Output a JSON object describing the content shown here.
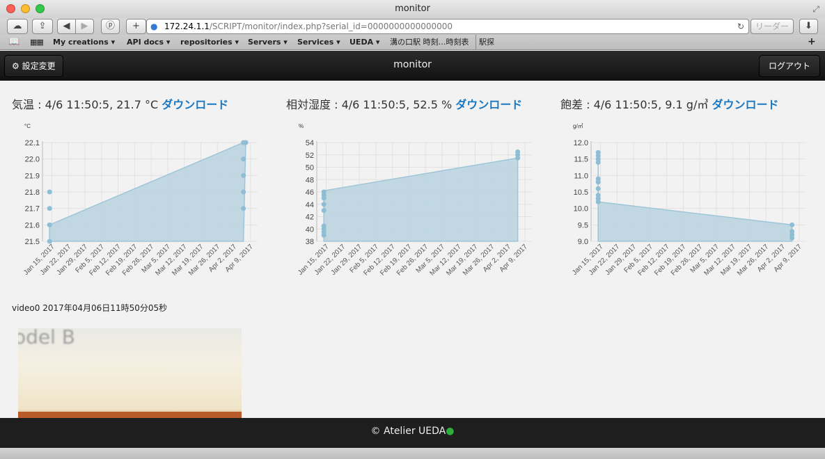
{
  "browser": {
    "window_title": "monitor",
    "url_host": "172.24.1.1",
    "url_path": "/SCRIPT/monitor/index.php?serial_id=0000000000000000",
    "reader_label": "リーダー",
    "bookmarks": [
      {
        "label": "My creations",
        "menu": true
      },
      {
        "label": "API docs",
        "menu": true
      },
      {
        "label": "repositories",
        "menu": true
      },
      {
        "label": "Servers",
        "menu": true
      },
      {
        "label": "Services",
        "menu": true
      },
      {
        "label": "UEDA",
        "menu": true
      },
      {
        "label": "溝の口駅 時刻…時刻表",
        "menu": false
      },
      {
        "label": "駅探",
        "menu": false
      }
    ]
  },
  "navbar": {
    "title": "monitor",
    "settings_label": "設定変更",
    "logout_label": "ログアウト"
  },
  "panels": [
    {
      "heading": "気温 : 4/6 11:50:5, 21.7 °C",
      "download": "ダウンロード",
      "unit": "°C"
    },
    {
      "heading": "相対湿度 : 4/6 11:50:5, 52.5 %",
      "download": "ダウンロード",
      "unit": "%"
    },
    {
      "heading": "飽差 : 4/6 11:50:5, 9.1 g/㎥",
      "download": "ダウンロード",
      "unit": "g/㎥"
    }
  ],
  "video": {
    "label": "video0 2017年04月06日11時50分05秒",
    "overlay_text": "odel B"
  },
  "footer": {
    "text": "© Atelier UEDA"
  },
  "colors": {
    "fill": "#b9d4e0",
    "line": "#9fc5d8",
    "point": "#8ebdd4",
    "link": "#1a78c2"
  },
  "chart_data": [
    {
      "type": "area",
      "ylabel": "°C",
      "x_ticks": [
        "Jan 15, 2017",
        "Jan 22, 2017",
        "Jan 29, 2017",
        "Feb 5, 2017",
        "Feb 12, 2017",
        "Feb 19, 2017",
        "Feb 26, 2017",
        "Mar 5, 2017",
        "Mar 12, 2017",
        "Mar 19, 2017",
        "Mar 26, 2017",
        "Apr 2, 2017",
        "Apr 9, 2017"
      ],
      "xlim": [
        "2017-01-11",
        "2017-04-12"
      ],
      "ylim": [
        21.5,
        22.1
      ],
      "y_ticks": [
        21.5,
        21.6,
        21.7,
        21.8,
        21.9,
        22.0,
        22.1
      ],
      "series": [
        {
          "points": [
            [
              "2017-01-14",
              21.5
            ],
            [
              "2017-01-14",
              21.6
            ],
            [
              "2017-01-14",
              21.7
            ],
            [
              "2017-01-14",
              21.8
            ],
            [
              "2017-01-14",
              21.6
            ],
            [
              "2017-04-06",
              21.7
            ],
            [
              "2017-04-06",
              21.8
            ],
            [
              "2017-04-06",
              21.9
            ],
            [
              "2017-04-06",
              22.0
            ],
            [
              "2017-04-06",
              22.1
            ],
            [
              "2017-04-07",
              22.1
            ]
          ]
        }
      ],
      "area_path": [
        [
          "2017-01-14",
          21.6
        ],
        [
          "2017-04-06",
          22.1
        ],
        [
          "2017-04-07",
          22.1
        ],
        [
          "2017-04-06",
          21.5
        ]
      ]
    },
    {
      "type": "area",
      "ylabel": "%",
      "x_ticks": [
        "Jan 15, 2017",
        "Jan 22, 2017",
        "Jan 29, 2017",
        "Feb 5, 2017",
        "Feb 12, 2017",
        "Feb 19, 2017",
        "Feb 26, 2017",
        "Mar 5, 2017",
        "Mar 12, 2017",
        "Mar 19, 2017",
        "Mar 26, 2017",
        "Apr 2, 2017",
        "Apr 9, 2017"
      ],
      "xlim": [
        "2017-01-11",
        "2017-04-12"
      ],
      "ylim": [
        38,
        54
      ],
      "y_ticks": [
        38,
        40,
        42,
        44,
        46,
        48,
        50,
        52,
        54
      ],
      "series": [
        {
          "points": [
            [
              "2017-01-14",
              39
            ],
            [
              "2017-01-14",
              39.5
            ],
            [
              "2017-01-14",
              40
            ],
            [
              "2017-01-14",
              40.5
            ],
            [
              "2017-01-14",
              43
            ],
            [
              "2017-01-14",
              44
            ],
            [
              "2017-01-14",
              45
            ],
            [
              "2017-01-14",
              45.5
            ],
            [
              "2017-01-14",
              46
            ],
            [
              "2017-04-06",
              51.5
            ],
            [
              "2017-04-06",
              52
            ],
            [
              "2017-04-06",
              52.5
            ]
          ]
        }
      ],
      "area_path": [
        [
          "2017-01-14",
          46.2
        ],
        [
          "2017-04-06",
          51.5
        ],
        [
          "2017-04-06",
          52.5
        ],
        [
          "2017-04-06",
          38
        ]
      ]
    },
    {
      "type": "area",
      "ylabel": "g/㎥",
      "x_ticks": [
        "Jan 15, 2017",
        "Jan 22, 2017",
        "Jan 29, 2017",
        "Feb 5, 2017",
        "Feb 12, 2017",
        "Feb 19, 2017",
        "Feb 26, 2017",
        "Mar 5, 2017",
        "Mar 12, 2017",
        "Mar 19, 2017",
        "Mar 26, 2017",
        "Apr 2, 2017",
        "Apr 9, 2017"
      ],
      "xlim": [
        "2017-01-11",
        "2017-04-12"
      ],
      "ylim": [
        9.0,
        12.0
      ],
      "y_ticks": [
        9.0,
        9.5,
        10.0,
        10.5,
        11.0,
        11.5,
        12.0
      ],
      "series": [
        {
          "points": [
            [
              "2017-01-14",
              10.2
            ],
            [
              "2017-01-14",
              10.3
            ],
            [
              "2017-01-14",
              10.4
            ],
            [
              "2017-01-14",
              10.6
            ],
            [
              "2017-01-14",
              10.8
            ],
            [
              "2017-01-14",
              10.9
            ],
            [
              "2017-01-14",
              11.4
            ],
            [
              "2017-01-14",
              11.5
            ],
            [
              "2017-01-14",
              11.6
            ],
            [
              "2017-01-14",
              11.7
            ],
            [
              "2017-04-06",
              9.1
            ],
            [
              "2017-04-06",
              9.2
            ],
            [
              "2017-04-06",
              9.3
            ],
            [
              "2017-04-06",
              9.5
            ]
          ]
        }
      ],
      "area_path": [
        [
          "2017-01-14",
          11.7
        ],
        [
          "2017-01-14",
          10.2
        ],
        [
          "2017-04-06",
          9.5
        ],
        [
          "2017-04-06",
          9.0
        ],
        [
          "2017-01-14",
          9.0
        ]
      ]
    }
  ]
}
